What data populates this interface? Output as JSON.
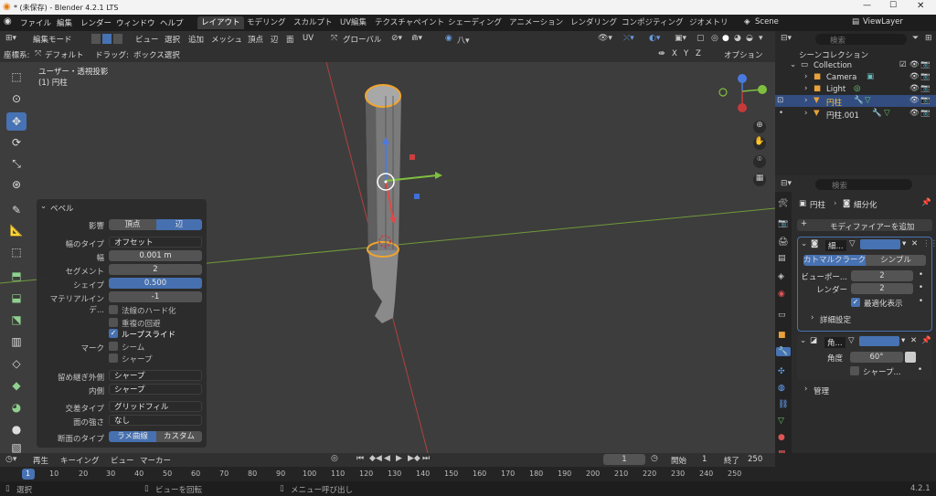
{
  "window": {
    "title": "* (未保存) - Blender 4.2.1 LTS"
  },
  "menubar": {
    "items": [
      "ファイル",
      "編集",
      "レンダー",
      "ウィンドウ",
      "ヘルプ"
    ],
    "workspaces": [
      "レイアウト",
      "モデリング",
      "スカルプト",
      "UV編集",
      "テクスチャペイント",
      "シェーディング",
      "アニメーション",
      "レンダリング",
      "コンポジティング",
      "ジオメトリ"
    ],
    "scene": "Scene",
    "viewlayer": "ViewLayer"
  },
  "header": {
    "mode": "編集モード",
    "items": [
      "ビュー",
      "選択",
      "追加",
      "メッシュ",
      "頂点",
      "辺",
      "面",
      "UV"
    ],
    "orientation": "グローバル"
  },
  "header2": {
    "coord_label": "座標系:",
    "coord_value": "デフォルト",
    "drag": "ドラッグ:",
    "select": "ボックス選択",
    "axes": [
      "X",
      "Y",
      "Z"
    ],
    "options": "オプション"
  },
  "viewport": {
    "view_label": "ユーザー・透視投影",
    "object_label": "(1) 円柱"
  },
  "bevel": {
    "title": "ベベル",
    "affect_label": "影響",
    "affect_options": [
      "頂点",
      "辺"
    ],
    "width_type_label": "幅のタイプ",
    "width_type": "オフセット",
    "width_label": "幅",
    "width": "0.001 m",
    "segments_label": "セグメント",
    "segments": "2",
    "shape_label": "シェイプ",
    "shape": "0.500",
    "material_label": "マテリアルインデ...",
    "material": "-1",
    "harden_normals": "法線のハード化",
    "clamp_overlap": "重複の回避",
    "loop_slide": "ループスライド",
    "mark_label": "マーク",
    "mark_seam": "シーム",
    "mark_sharp": "シャープ",
    "miter_outer_label": "留め継ぎ外側",
    "miter_outer": "シャープ",
    "miter_inner_label": "内側",
    "miter_inner": "シャープ",
    "intersection_label": "交差タイプ",
    "intersection": "グリッドフィル",
    "face_strength_label": "面の強さ",
    "face_strength": "なし",
    "profile_label": "断面のタイプ",
    "profile_options": [
      "ラメ曲線",
      "カスタム"
    ]
  },
  "timeline": {
    "playback": "再生",
    "keying": "キーイング",
    "view": "ビュー",
    "marker": "マーカー",
    "current": "1",
    "start_label": "開始",
    "start": "1",
    "end_label": "終了",
    "end": "250",
    "ticks": [
      "1",
      "10",
      "20",
      "30",
      "40",
      "50",
      "60",
      "70",
      "80",
      "90",
      "100",
      "110",
      "120",
      "130",
      "140",
      "150",
      "160",
      "170",
      "180",
      "190",
      "200",
      "210",
      "220",
      "230",
      "240",
      "250"
    ]
  },
  "status": {
    "select": "選択",
    "rotate": "ビューを回転",
    "menu": "メニュー呼び出し",
    "version": "4.2.1"
  },
  "outliner": {
    "title": "シーンコレクション",
    "search_placeholder": "検索",
    "rows": [
      "Collection",
      "Camera",
      "Light",
      "円柱",
      "円柱.001"
    ]
  },
  "properties": {
    "search_placeholder": "検索",
    "breadcrumb_object": "円柱",
    "breadcrumb_modifier": "細分化",
    "add_modifier": "モディファイアーを追加",
    "subsurf": {
      "name": "細...",
      "types": [
        "カトマルクラーク",
        "シンプル"
      ],
      "viewport_label": "ビューポー...",
      "viewport": "2",
      "render_label": "レンダー",
      "render": "2",
      "optimal": "最適化表示",
      "advanced": "詳細設定"
    },
    "bevelmod": {
      "name": "角...",
      "angle_label": "角度",
      "angle": "60°",
      "sharp": "シャープ..."
    },
    "manage": "管理"
  },
  "colors": {
    "accent": "#4772b3",
    "select_orange": "#f0a530",
    "x_axis": "#7fbf3f",
    "y_axis": "#d04040"
  }
}
